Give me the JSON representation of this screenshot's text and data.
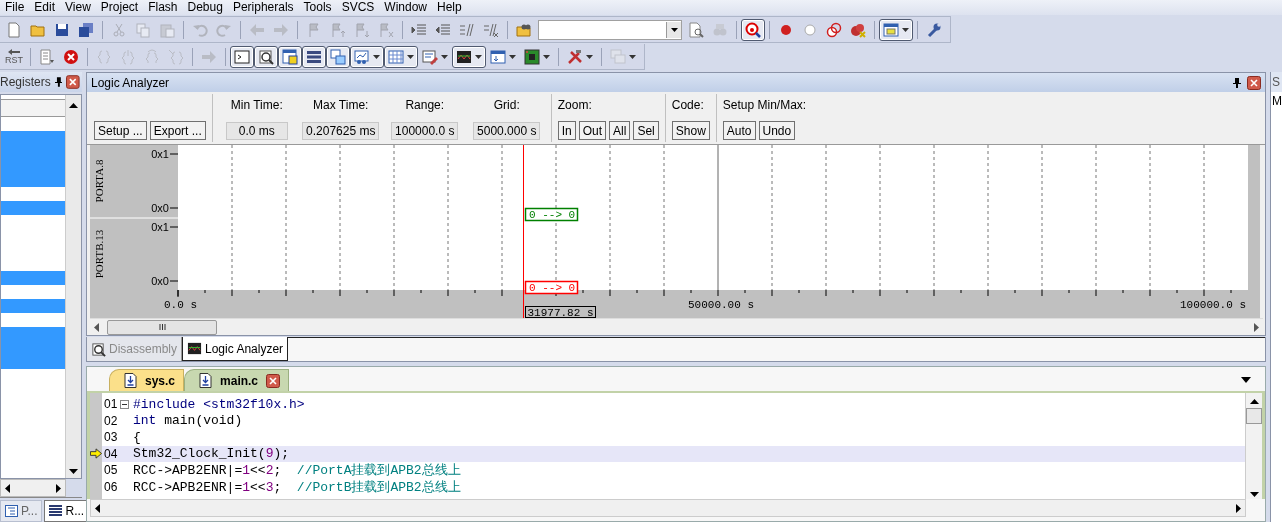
{
  "menu": [
    "File",
    "Edit",
    "View",
    "Project",
    "Flash",
    "Debug",
    "Peripherals",
    "Tools",
    "SVCS",
    "Window",
    "Help"
  ],
  "toolbar_1": [
    {
      "kind": "button",
      "disabled": false,
      "pressed": false,
      "dropdown": false
    },
    {
      "kind": "button",
      "disabled": false,
      "pressed": false,
      "dropdown": false
    },
    {
      "kind": "button",
      "disabled": false,
      "pressed": false,
      "dropdown": false
    },
    {
      "kind": "button",
      "disabled": false,
      "pressed": false,
      "dropdown": false
    },
    {
      "kind": "separator"
    },
    {
      "kind": "button",
      "disabled": true,
      "pressed": false,
      "dropdown": false
    },
    {
      "kind": "button",
      "disabled": true,
      "pressed": false,
      "dropdown": false
    },
    {
      "kind": "button",
      "disabled": true,
      "pressed": false,
      "dropdown": false
    },
    {
      "kind": "separator"
    },
    {
      "kind": "button",
      "disabled": true,
      "pressed": false,
      "dropdown": false
    },
    {
      "kind": "button",
      "disabled": true,
      "pressed": false,
      "dropdown": false
    },
    {
      "kind": "separator"
    },
    {
      "kind": "button",
      "disabled": true,
      "pressed": false,
      "dropdown": false
    },
    {
      "kind": "button",
      "disabled": true,
      "pressed": false,
      "dropdown": false
    },
    {
      "kind": "separator"
    },
    {
      "kind": "button",
      "disabled": true,
      "pressed": false,
      "dropdown": false
    },
    {
      "kind": "button",
      "disabled": true,
      "pressed": false,
      "dropdown": false
    },
    {
      "kind": "button",
      "disabled": true,
      "pressed": false,
      "dropdown": false
    },
    {
      "kind": "button",
      "disabled": true,
      "pressed": false,
      "dropdown": false
    },
    {
      "kind": "separator"
    },
    {
      "kind": "button",
      "disabled": false,
      "pressed": false,
      "dropdown": false
    },
    {
      "kind": "button",
      "disabled": false,
      "pressed": false,
      "dropdown": false
    },
    {
      "kind": "button",
      "disabled": false,
      "pressed": false,
      "dropdown": false
    },
    {
      "kind": "button",
      "disabled": false,
      "pressed": false,
      "dropdown": false
    },
    {
      "kind": "separator"
    },
    {
      "kind": "button",
      "disabled": false,
      "pressed": false,
      "dropdown": false
    },
    {
      "kind": "combo"
    },
    {
      "kind": "button",
      "disabled": false,
      "pressed": false,
      "dropdown": false
    },
    {
      "kind": "button",
      "disabled": true,
      "pressed": false,
      "dropdown": false
    },
    {
      "kind": "separator"
    },
    {
      "kind": "button",
      "disabled": false,
      "pressed": true,
      "dropdown": false
    },
    {
      "kind": "separator"
    },
    {
      "kind": "button",
      "disabled": false,
      "pressed": false,
      "dropdown": false
    },
    {
      "kind": "button",
      "disabled": false,
      "pressed": false,
      "dropdown": false
    },
    {
      "kind": "button",
      "disabled": false,
      "pressed": false,
      "dropdown": false
    },
    {
      "kind": "button",
      "disabled": false,
      "pressed": false,
      "dropdown": false
    },
    {
      "kind": "separator"
    },
    {
      "kind": "button",
      "disabled": false,
      "pressed": true,
      "dropdown": true
    },
    {
      "kind": "separator"
    },
    {
      "kind": "button",
      "disabled": false,
      "pressed": false,
      "dropdown": false
    }
  ],
  "toolbar_2": [
    {
      "kind": "button",
      "label": "RST",
      "disabled": false,
      "pressed": false,
      "dropdown": false
    },
    {
      "kind": "separator"
    },
    {
      "kind": "button",
      "disabled": false,
      "pressed": false,
      "dropdown": false
    },
    {
      "kind": "button",
      "disabled": false,
      "pressed": false,
      "dropdown": false
    },
    {
      "kind": "separator"
    },
    {
      "kind": "button",
      "disabled": true,
      "pressed": false,
      "dropdown": false
    },
    {
      "kind": "button",
      "disabled": true,
      "pressed": false,
      "dropdown": false
    },
    {
      "kind": "button",
      "disabled": true,
      "pressed": false,
      "dropdown": false
    },
    {
      "kind": "button",
      "disabled": true,
      "pressed": false,
      "dropdown": false
    },
    {
      "kind": "separator"
    },
    {
      "kind": "button",
      "disabled": true,
      "pressed": false,
      "dropdown": false
    },
    {
      "kind": "separator"
    },
    {
      "kind": "button",
      "disabled": false,
      "pressed": true,
      "dropdown": false
    },
    {
      "kind": "button",
      "disabled": false,
      "pressed": true,
      "dropdown": false
    },
    {
      "kind": "button",
      "disabled": false,
      "pressed": true,
      "dropdown": false
    },
    {
      "kind": "button",
      "disabled": false,
      "pressed": true,
      "dropdown": false
    },
    {
      "kind": "button",
      "disabled": false,
      "pressed": true,
      "dropdown": false
    },
    {
      "kind": "button",
      "disabled": false,
      "pressed": true,
      "dropdown": true
    },
    {
      "kind": "button",
      "disabled": false,
      "pressed": true,
      "dropdown": true
    },
    {
      "kind": "button",
      "disabled": false,
      "pressed": false,
      "dropdown": true
    },
    {
      "kind": "button",
      "disabled": false,
      "pressed": true,
      "dropdown": true
    },
    {
      "kind": "button",
      "disabled": false,
      "pressed": false,
      "dropdown": true
    },
    {
      "kind": "button",
      "disabled": false,
      "pressed": false,
      "dropdown": true
    },
    {
      "kind": "separator"
    },
    {
      "kind": "button",
      "disabled": false,
      "pressed": false,
      "dropdown": true
    },
    {
      "kind": "separator"
    },
    {
      "kind": "button",
      "disabled": true,
      "pressed": false,
      "dropdown": true
    }
  ],
  "registers_panel": {
    "title": "Registers",
    "rows": [
      {
        "selected": false
      },
      {
        "selected": true
      },
      {
        "selected": true
      },
      {
        "selected": true
      },
      {
        "selected": true
      },
      {
        "selected": false
      },
      {
        "selected": true
      },
      {
        "selected": false
      },
      {
        "selected": false
      },
      {
        "selected": false
      },
      {
        "selected": false
      },
      {
        "selected": true
      },
      {
        "selected": false
      },
      {
        "selected": true
      },
      {
        "selected": false
      },
      {
        "selected": true
      },
      {
        "selected": true
      },
      {
        "selected": true
      },
      {
        "selected": false
      },
      {
        "selected": false
      },
      {
        "selected": false
      },
      {
        "selected": false
      },
      {
        "selected": false
      },
      {
        "selected": false
      }
    ],
    "tabs": [
      {
        "label": "P...",
        "selected": false
      },
      {
        "label": "R...",
        "selected": true
      }
    ]
  },
  "logic_analyzer": {
    "title": "Logic Analyzer",
    "setup_buttons": [
      "Setup ...",
      "Export ..."
    ],
    "readouts": [
      {
        "label": "Min Time:",
        "value": "0.0 ms"
      },
      {
        "label": "Max Time:",
        "value": "0.207625 ms"
      },
      {
        "label": "Range:",
        "value": "100000.0 s"
      },
      {
        "label": "Grid:",
        "value": "5000.000 s"
      }
    ],
    "button_groups": [
      {
        "label": "Zoom:",
        "buttons": [
          "In",
          "Out",
          "All",
          "Sel"
        ]
      },
      {
        "label": "Code:",
        "buttons": [
          "Show"
        ]
      },
      {
        "label": "Setup Min/Max:",
        "buttons": [
          "Auto",
          "Undo"
        ]
      }
    ],
    "signals": [
      {
        "name": "PORTA.8",
        "high_label": "0x1",
        "low_label": "0x0",
        "transition": "0 --> 0",
        "color": "#008000"
      },
      {
        "name": "PORTB.13",
        "high_label": "0x1",
        "low_label": "0x0",
        "transition": "0 --> 0",
        "color": "#ff0000"
      }
    ],
    "time_axis": [
      "0.0 s",
      "50000.00 s",
      "100000.0 s"
    ],
    "cursor_time": "31977.82 s"
  },
  "view_tabs": [
    {
      "label": "Disassembly",
      "selected": false
    },
    {
      "label": "Logic Analyzer",
      "selected": true
    }
  ],
  "editor": {
    "tabs": [
      {
        "label": "sys.c",
        "selected": false
      },
      {
        "label": "main.c",
        "selected": true
      }
    ],
    "lines": [
      {
        "number": "01",
        "current": false,
        "foldable": true,
        "tokens": [
          {
            "kind": "keyword",
            "text": "#include <stm32f10x.h>"
          }
        ]
      },
      {
        "number": "02",
        "current": false,
        "foldable": false,
        "tokens": [
          {
            "kind": "keyword",
            "text": "int"
          },
          {
            "kind": "plain",
            "text": " main(void)"
          }
        ]
      },
      {
        "number": "03",
        "current": false,
        "foldable": false,
        "tokens": [
          {
            "kind": "plain",
            "text": "{"
          }
        ]
      },
      {
        "number": "04",
        "current": true,
        "foldable": false,
        "tokens": [
          {
            "kind": "plain",
            "text": "Stm32_Clock_Init("
          },
          {
            "kind": "number",
            "text": "9"
          },
          {
            "kind": "plain",
            "text": ");"
          }
        ]
      },
      {
        "number": "05",
        "current": false,
        "foldable": false,
        "tokens": [
          {
            "kind": "plain",
            "text": "RCC->APB2ENR|="
          },
          {
            "kind": "number",
            "text": "1"
          },
          {
            "kind": "plain",
            "text": "<<"
          },
          {
            "kind": "number",
            "text": "2"
          },
          {
            "kind": "plain",
            "text": ";  "
          },
          {
            "kind": "comment",
            "text": "//PortA挂载到APB2总线上"
          }
        ]
      },
      {
        "number": "06",
        "current": false,
        "foldable": false,
        "tokens": [
          {
            "kind": "plain",
            "text": "RCC->APB2ENR|="
          },
          {
            "kind": "number",
            "text": "1"
          },
          {
            "kind": "plain",
            "text": "<<"
          },
          {
            "kind": "number",
            "text": "3"
          },
          {
            "kind": "plain",
            "text": ";  "
          },
          {
            "kind": "comment",
            "text": "//PortB挂载到APB2总线上"
          }
        ]
      }
    ]
  },
  "right_panel": {
    "title": "S",
    "label": "M"
  }
}
